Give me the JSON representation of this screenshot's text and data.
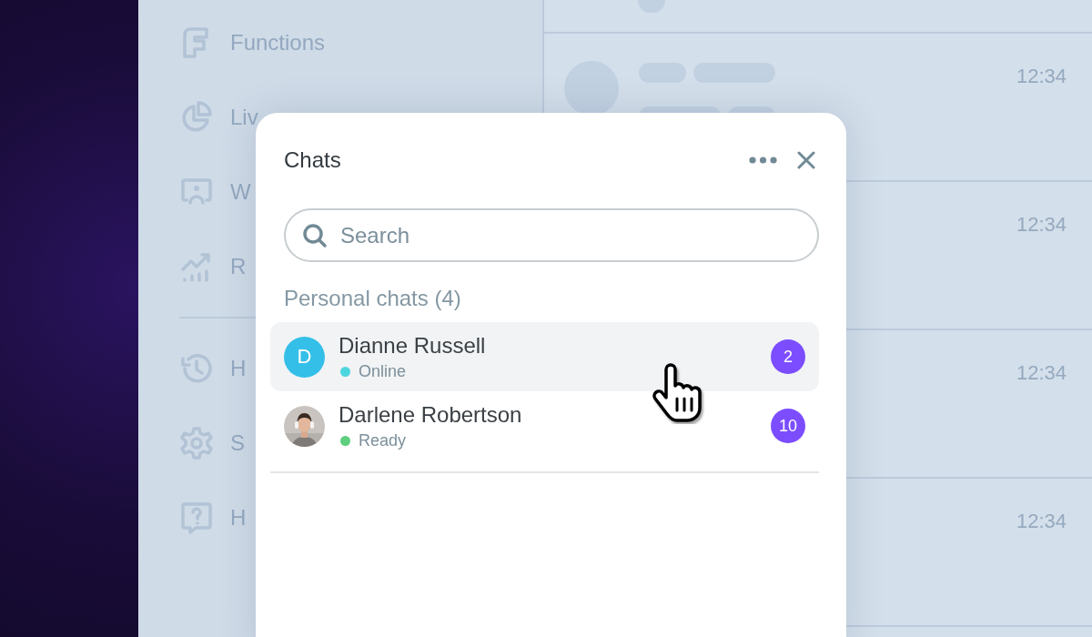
{
  "sidebar": {
    "items": [
      {
        "label": "Functions",
        "kind": "functions"
      },
      {
        "label": "Liv",
        "kind": "monitor"
      },
      {
        "label": "W",
        "kind": "agent"
      },
      {
        "label": "R",
        "kind": "reports"
      }
    ],
    "bottom_items": [
      {
        "label": "H",
        "kind": "history"
      },
      {
        "label": "S",
        "kind": "settings"
      },
      {
        "label": "H",
        "kind": "help"
      }
    ]
  },
  "conversations": [
    {
      "time": "12:34"
    },
    {
      "time": "12:34"
    },
    {
      "time": "12:34"
    },
    {
      "time": "12:34"
    }
  ],
  "chats_panel": {
    "title": "Chats",
    "search": {
      "placeholder": "Search"
    },
    "section": "Personal chats (4)",
    "contacts": [
      {
        "name": "Dianne Russell",
        "initial": "D",
        "kind": "initial",
        "status": "Online",
        "color": "#4dd6e0",
        "unread": "2",
        "selected": true
      },
      {
        "name": "Darlene Robertson",
        "status": "Ready",
        "color": "#5fce7e",
        "unread": "10",
        "selected": false
      }
    ]
  }
}
